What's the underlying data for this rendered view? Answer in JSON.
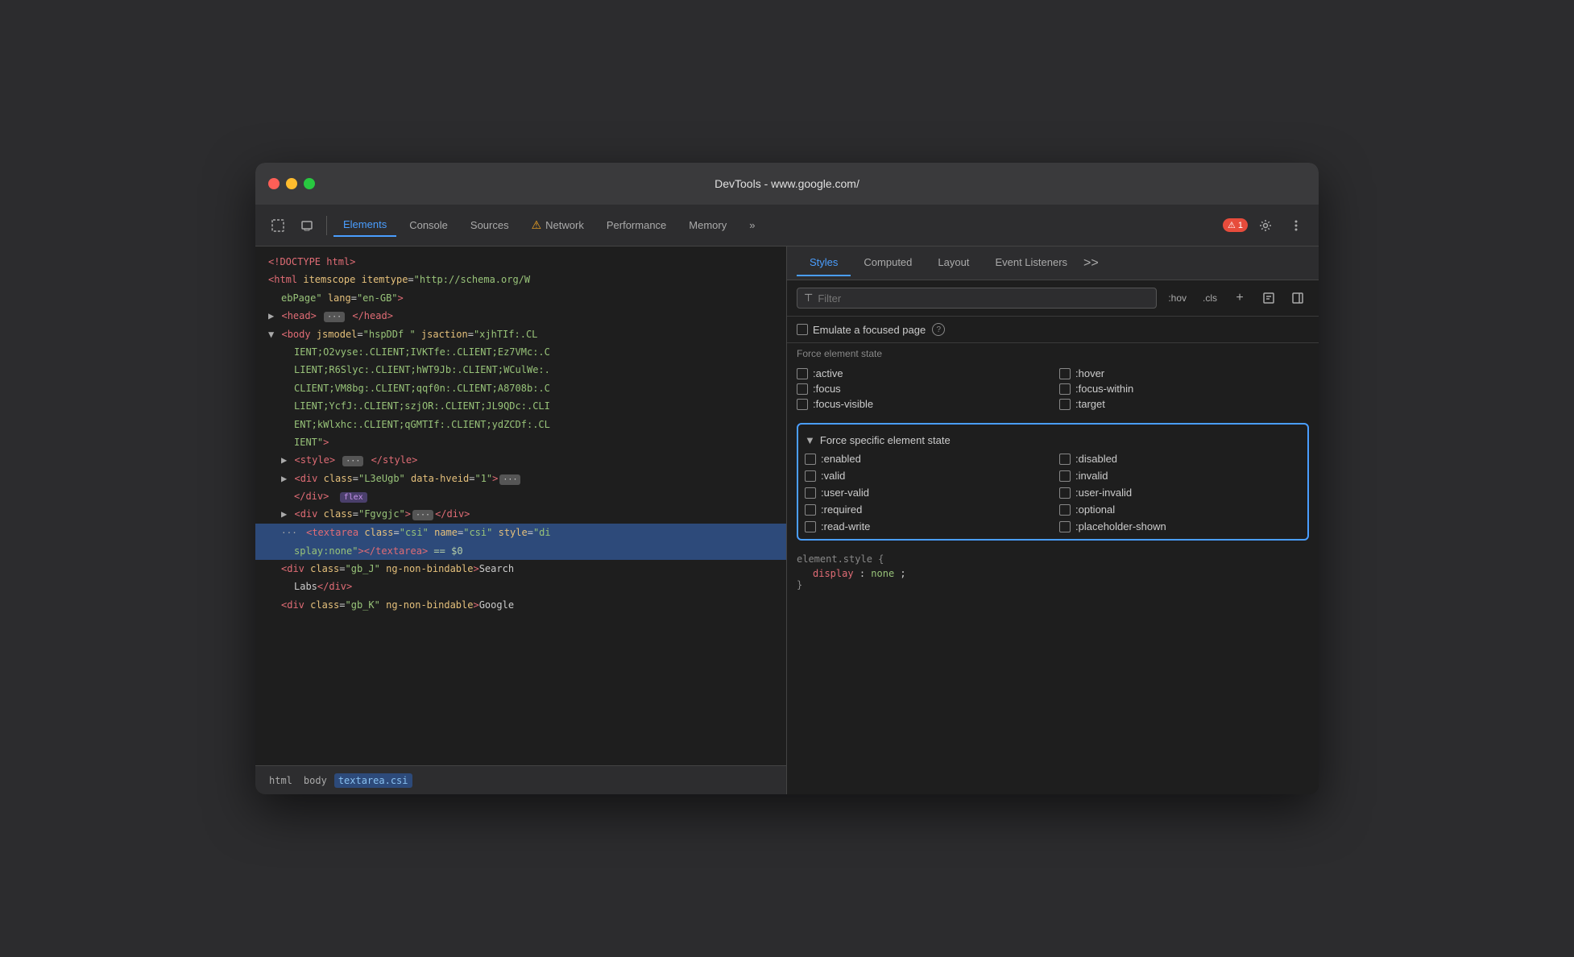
{
  "window": {
    "title": "DevTools - www.google.com/"
  },
  "titlebar": {
    "buttons": {
      "close": "●",
      "minimize": "●",
      "maximize": "●"
    }
  },
  "toolbar": {
    "tabs": [
      {
        "id": "elements",
        "label": "Elements",
        "active": true
      },
      {
        "id": "console",
        "label": "Console",
        "active": false
      },
      {
        "id": "sources",
        "label": "Sources",
        "active": false
      },
      {
        "id": "network",
        "label": "Network",
        "active": false,
        "warning": true
      },
      {
        "id": "performance",
        "label": "Performance",
        "active": false
      },
      {
        "id": "memory",
        "label": "Memory",
        "active": false
      }
    ],
    "badge_count": "1",
    "more_tabs": "»"
  },
  "dom": {
    "lines": [
      {
        "text": "<!DOCTYPE html>",
        "indent": 0
      },
      {
        "text": "<html itemscope itemtype=\"http://schema.org/W",
        "indent": 0
      },
      {
        "text": "ebPage\" lang=\"en-GB\">",
        "indent": 2
      },
      {
        "text": "▶ <head> … </head>",
        "indent": 0
      },
      {
        "text": "▼ <body jsmodel=\"hspDDf \" jsaction=\"xjhTIf:.CL",
        "indent": 0
      },
      {
        "text": "IENT;O2vyse:.CLIENT;IVKTfe:.CLIENT;Ez7VMc:.C",
        "indent": 2
      },
      {
        "text": "LIENT;R6Slyc:.CLIENT;hWT9Jb:.CLIENT;WCulWe:.",
        "indent": 2
      },
      {
        "text": "CLIENT;VM8bg:.CLIENT;qqf0n:.CLIENT;A8708b:.C",
        "indent": 2
      },
      {
        "text": "LIENT;YcfJ:.CLIENT;szjOR:.CLIENT;JL9QDc:.CLI",
        "indent": 2
      },
      {
        "text": "ENT;kWlxhc:.CLIENT;qGMTIf:.CLIENT;ydZCDf:.CL",
        "indent": 2
      },
      {
        "text": "IENT\">",
        "indent": 2
      },
      {
        "text": "▶ <style> … </style>",
        "indent": 1
      },
      {
        "text": "▶ <div class=\"L3eUgb\" data-hveid=\"1\"> …",
        "indent": 1
      },
      {
        "text": "   </div>",
        "indent": 1
      },
      {
        "text": "▶ <div class=\"Fgvgjc\"> … </div>",
        "indent": 1
      },
      {
        "text": "<textarea class=\"csi\" name=\"csi\" style=\"di",
        "indent": 1,
        "selected": true
      },
      {
        "text": "splay:none\"></textarea> == $0",
        "indent": 2,
        "selected": true
      },
      {
        "text": "<div class=\"gb_J\" ng-non-bindable>Search",
        "indent": 1
      },
      {
        "text": "Labs</div>",
        "indent": 2
      },
      {
        "text": "<div class=\"gb_K\" ng-non-bindable>Google",
        "indent": 1
      }
    ]
  },
  "breadcrumb": {
    "items": [
      "html",
      "body",
      "textarea.csi"
    ]
  },
  "right_panel": {
    "tabs": [
      "Styles",
      "Computed",
      "Layout",
      "Event Listeners"
    ],
    "active_tab": "Styles",
    "more": ">>"
  },
  "styles_panel": {
    "filter": {
      "placeholder": "Filter",
      "hov_label": ":hov",
      "cls_label": ".cls"
    },
    "emulate_focused": {
      "label": "Emulate a focused page"
    },
    "force_element_state": {
      "title": "Force element state",
      "states_left": [
        ":active",
        ":focus",
        ":focus-visible"
      ],
      "states_right": [
        ":hover",
        ":focus-within",
        ":target"
      ]
    },
    "force_specific": {
      "title": "Force specific element state",
      "states_left": [
        ":enabled",
        ":valid",
        ":user-valid",
        ":required",
        ":read-write"
      ],
      "states_right": [
        ":disabled",
        ":invalid",
        ":user-invalid",
        ":optional",
        ":placeholder-shown"
      ]
    },
    "element_style": {
      "selector": "element.style {",
      "property_name": "display",
      "property_value": "none",
      "close": "}"
    }
  }
}
